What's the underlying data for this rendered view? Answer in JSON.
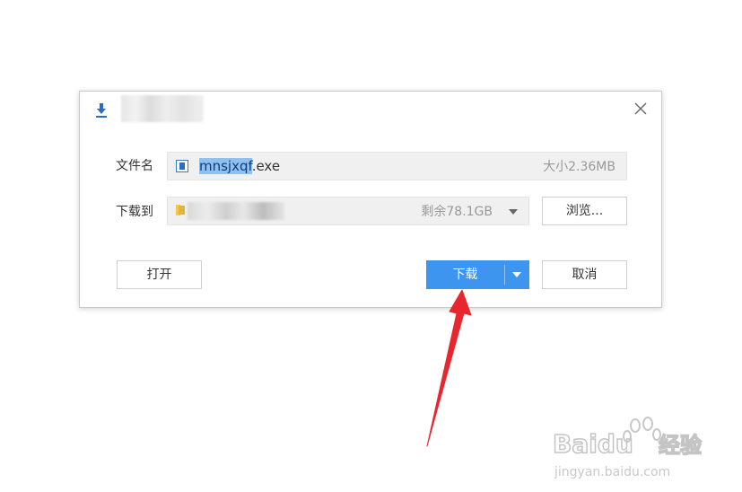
{
  "dialog": {
    "close_symbol": "✕",
    "file_label": "文件名",
    "file_name_selected": "mnsjxqf",
    "file_name_ext": ".exe",
    "file_size": "大小2.36MB",
    "save_label": "下载到",
    "free_space": "剩余78.1GB",
    "browse_label": "浏览...",
    "open_label": "打开",
    "download_label": "下载",
    "cancel_label": "取消"
  },
  "watermark": {
    "brand": "Baidu",
    "product": "经验",
    "url_text": "jingyan.baidu.com"
  },
  "colors": {
    "primary_button": "#3d95f0",
    "selection": "#8ec1ef",
    "arrow": "#e8262e",
    "download_icon": "#2b6cc4"
  }
}
